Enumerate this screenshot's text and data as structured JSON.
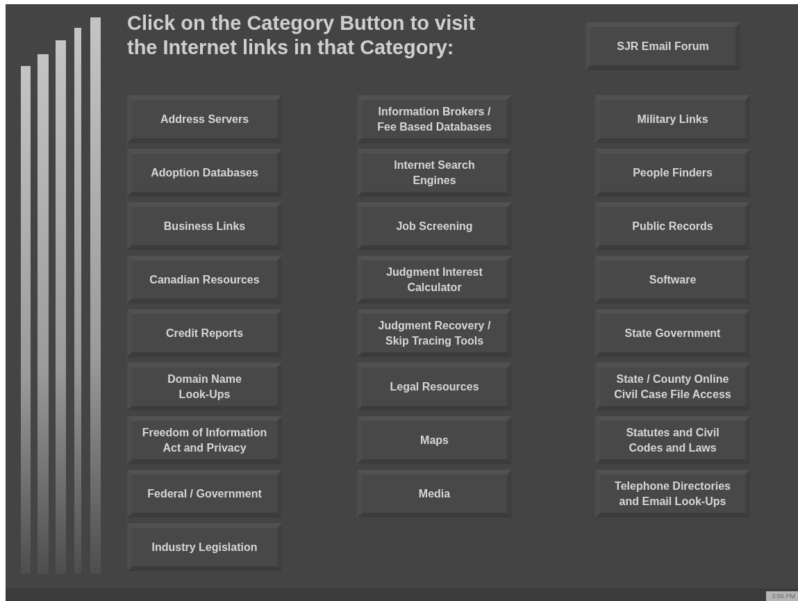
{
  "heading": [
    "Click on the Category Button to visit",
    "the Internet links in that Category:"
  ],
  "forum_button": {
    "lines": [
      "SJR Email Forum"
    ]
  },
  "columns": [
    [
      {
        "lines": [
          "Address Servers"
        ]
      },
      {
        "lines": [
          "Adoption Databases"
        ]
      },
      {
        "lines": [
          "Business Links"
        ]
      },
      {
        "lines": [
          "Canadian Resources"
        ]
      },
      {
        "lines": [
          "Credit Reports"
        ]
      },
      {
        "lines": [
          "Domain Name",
          "Look-Ups"
        ]
      },
      {
        "lines": [
          "Freedom of Information",
          "Act and Privacy"
        ]
      },
      {
        "lines": [
          "Federal / Government"
        ]
      },
      {
        "lines": [
          "Industry Legislation"
        ]
      }
    ],
    [
      {
        "lines": [
          "Information Brokers  /",
          "Fee Based Databases"
        ]
      },
      {
        "lines": [
          "Internet Search",
          "Engines"
        ]
      },
      {
        "lines": [
          "Job Screening"
        ]
      },
      {
        "lines": [
          "Judgment Interest",
          "Calculator"
        ]
      },
      {
        "lines": [
          "Judgment Recovery /",
          "Skip Tracing Tools"
        ]
      },
      {
        "lines": [
          "Legal Resources"
        ]
      },
      {
        "lines": [
          "Maps"
        ]
      },
      {
        "lines": [
          "Media"
        ]
      }
    ],
    [
      {
        "lines": [
          "Military Links"
        ]
      },
      {
        "lines": [
          "People Finders"
        ]
      },
      {
        "lines": [
          "Public Records"
        ]
      },
      {
        "lines": [
          "Software"
        ]
      },
      {
        "lines": [
          "State Government"
        ]
      },
      {
        "lines": [
          "State / County Online",
          "Civil Case File Access"
        ]
      },
      {
        "lines": [
          "Statutes and Civil",
          "Codes and Laws"
        ]
      },
      {
        "lines": [
          "Telephone Directories",
          "and Email Look-Ups"
        ]
      }
    ]
  ],
  "clock": "2:56 PM"
}
